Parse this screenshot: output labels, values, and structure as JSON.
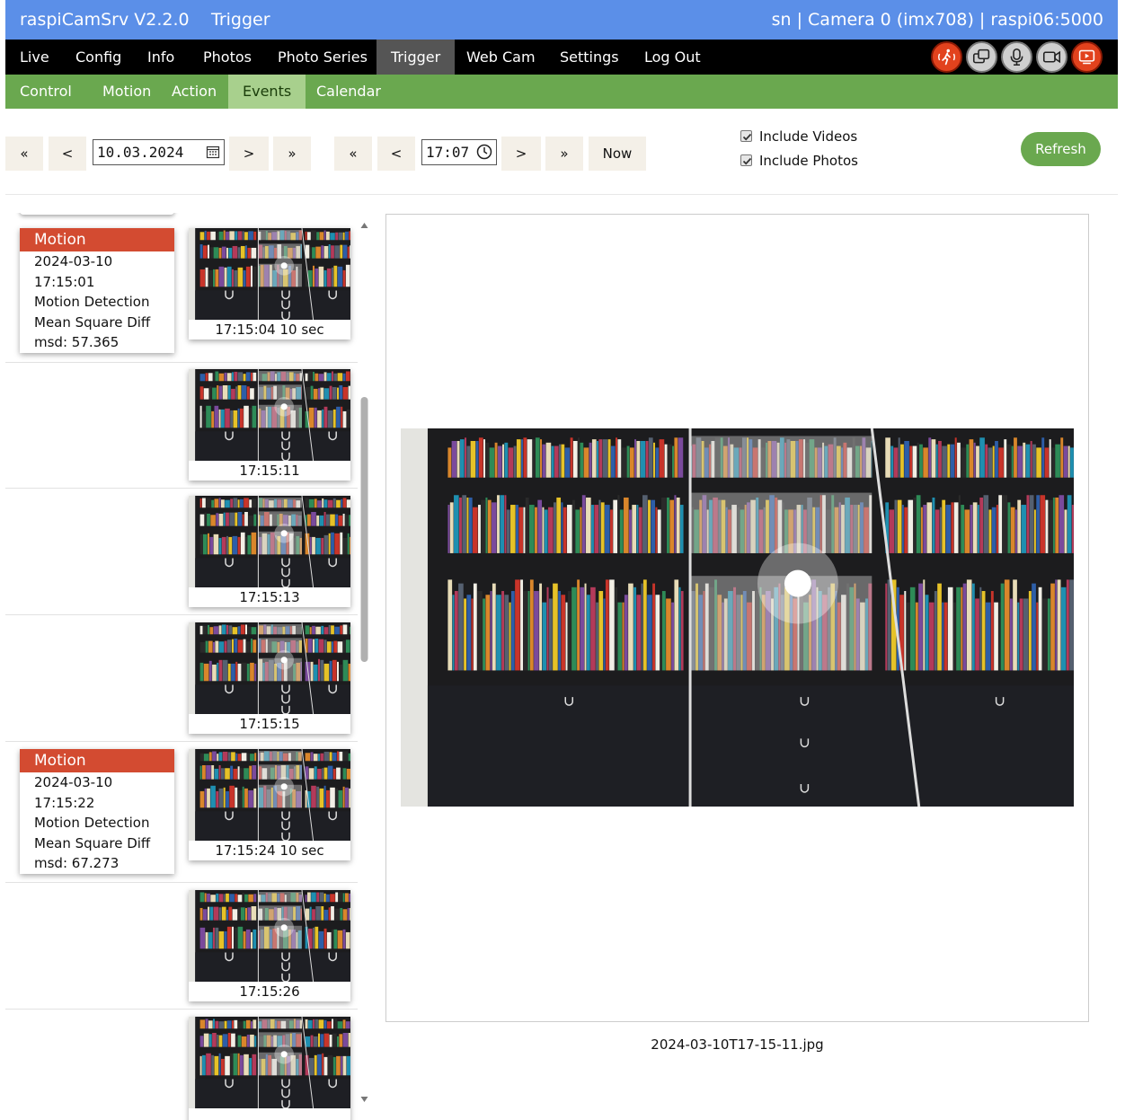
{
  "titlebar": {
    "app": "raspiCamSrv V2.2.0",
    "page": "Trigger",
    "host": "sn | Camera 0 (imx708) | raspi06:5000"
  },
  "mainnav": {
    "items": [
      "Live",
      "Config",
      "Info",
      "Photos",
      "Photo Series",
      "Trigger",
      "Web Cam",
      "Settings",
      "Log Out"
    ],
    "active": "Trigger",
    "icons": [
      "motion-alarm-icon",
      "dual-camera-icon",
      "microphone-icon",
      "video-camera-icon",
      "video-stream-icon"
    ]
  },
  "subnav": {
    "items": [
      "Control",
      "Motion",
      "Action",
      "Events",
      "Calendar"
    ],
    "active": "Events"
  },
  "filter": {
    "date_first": "«",
    "date_prev": "<",
    "date_value": "10.03.2024",
    "date_next": ">",
    "date_last": "»",
    "time_first": "«",
    "time_prev": "<",
    "time_value": "17:07",
    "time_next": ">",
    "time_last": "»",
    "now_label": "Now",
    "include_videos_label": "Include Videos",
    "include_videos": true,
    "include_photos_label": "Include Photos",
    "include_photos": true,
    "refresh_label": "Refresh"
  },
  "events": [
    {
      "event": {
        "type": "Motion",
        "date": "2024-03-10",
        "time": "17:15:01",
        "trigger": "Motion Detection",
        "algorithm": "Mean Square Diff",
        "metric": "msd: 57.365"
      },
      "caption": "17:15:04  10 sec"
    },
    {
      "caption": "17:15:11"
    },
    {
      "caption": "17:15:13"
    },
    {
      "caption": "17:15:15"
    },
    {
      "event": {
        "type": "Motion",
        "date": "2024-03-10",
        "time": "17:15:22",
        "trigger": "Motion Detection",
        "algorithm": "Mean Square Diff",
        "metric": "msd: 67.273"
      },
      "caption": "17:15:24  10 sec"
    },
    {
      "caption": "17:15:26"
    },
    {
      "caption": ""
    }
  ],
  "viewer": {
    "filename": "2024-03-10T17-15-11.jpg"
  },
  "colors": {
    "titlebar": "#5b8fe8",
    "nav": "#000000",
    "subnav": "#6aa84f",
    "event_header": "#d34b31",
    "alarm_icon": "#e2421d"
  }
}
